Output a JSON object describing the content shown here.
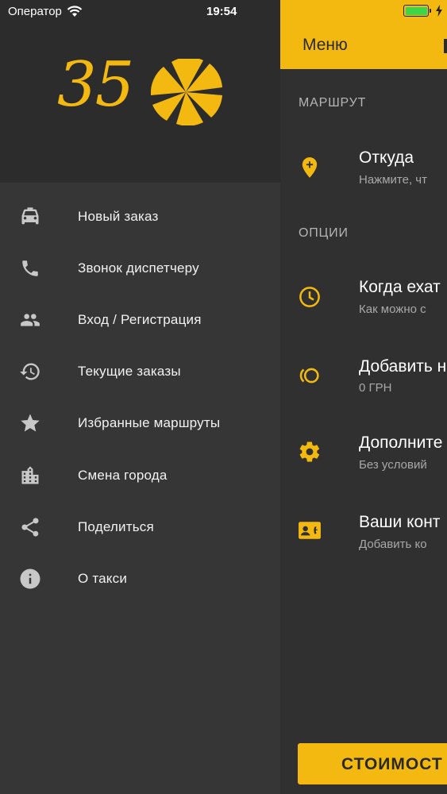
{
  "status_bar": {
    "carrier": "Оператор",
    "time": "19:54"
  },
  "logo": {
    "text": "35"
  },
  "menu": {
    "items": [
      {
        "label": "Новый заказ",
        "icon": "taxi-icon"
      },
      {
        "label": "Звонок диспетчеру",
        "icon": "phone-icon"
      },
      {
        "label": "Вход / Регистрация",
        "icon": "people-icon"
      },
      {
        "label": "Текущие заказы",
        "icon": "history-icon"
      },
      {
        "label": "Избранные маршруты",
        "icon": "star-icon"
      },
      {
        "label": "Смена города",
        "icon": "city-icon"
      },
      {
        "label": "Поделиться",
        "icon": "share-icon"
      },
      {
        "label": "О такси",
        "icon": "info-icon"
      }
    ]
  },
  "main": {
    "header_title": "Меню",
    "route_section": "МАРШРУТ",
    "from": {
      "title": "Откуда",
      "subtitle": "Нажмите, чт"
    },
    "options_section": "ОПЦИИ",
    "when": {
      "title": "Когда ехат",
      "subtitle": "Как можно с"
    },
    "add": {
      "title": "Добавить н",
      "subtitle": "0 ГРН"
    },
    "extra": {
      "title": "Дополните",
      "subtitle": "Без условий"
    },
    "contacts": {
      "title": "Ваши конт",
      "subtitle": "Добавить ко"
    },
    "price_button": "СТОИМОСТ"
  },
  "colors": {
    "accent": "#f4b910",
    "drawer_bg": "#363636",
    "header_bg": "#2c2c2c",
    "main_bg": "#303030"
  }
}
